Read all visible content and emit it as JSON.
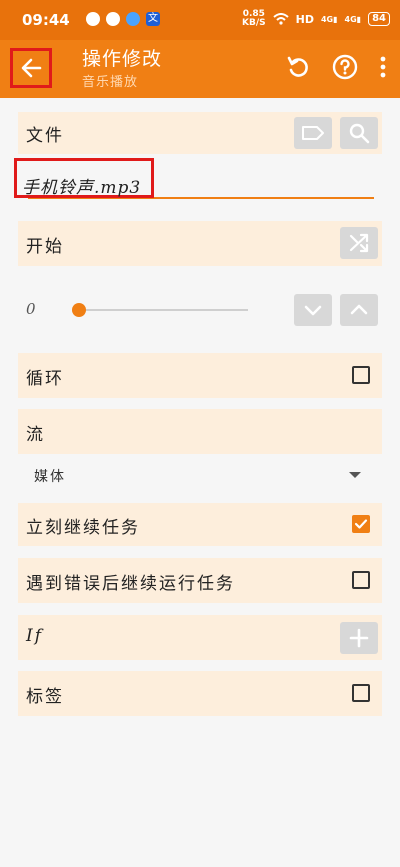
{
  "statusbar": {
    "time": "09:44",
    "speed_value": "0.85",
    "speed_unit": "KB/S",
    "hd_label": "HD",
    "network_label_1": "4G",
    "network_label_2": "4G",
    "battery": "84"
  },
  "toolbar": {
    "title": "操作修改",
    "subtitle": "音乐播放"
  },
  "file": {
    "label": "文件",
    "value": "手机铃声.mp3"
  },
  "start": {
    "label": "开始"
  },
  "slider": {
    "value": "0"
  },
  "loop": {
    "label": "循环",
    "checked": false
  },
  "stream": {
    "label": "流",
    "selected": "媒体"
  },
  "continue_immediately": {
    "label": "立刻继续任务",
    "checked": true
  },
  "continue_on_error": {
    "label": "遇到错误后继续运行任务",
    "checked": false
  },
  "if_section": {
    "label": "If"
  },
  "tag": {
    "label": "标签",
    "checked": false
  },
  "colors": {
    "accent": "#f07f14",
    "statusbar": "#e8720c",
    "card_bg": "#fdeedc",
    "highlight": "#e01a1a"
  }
}
